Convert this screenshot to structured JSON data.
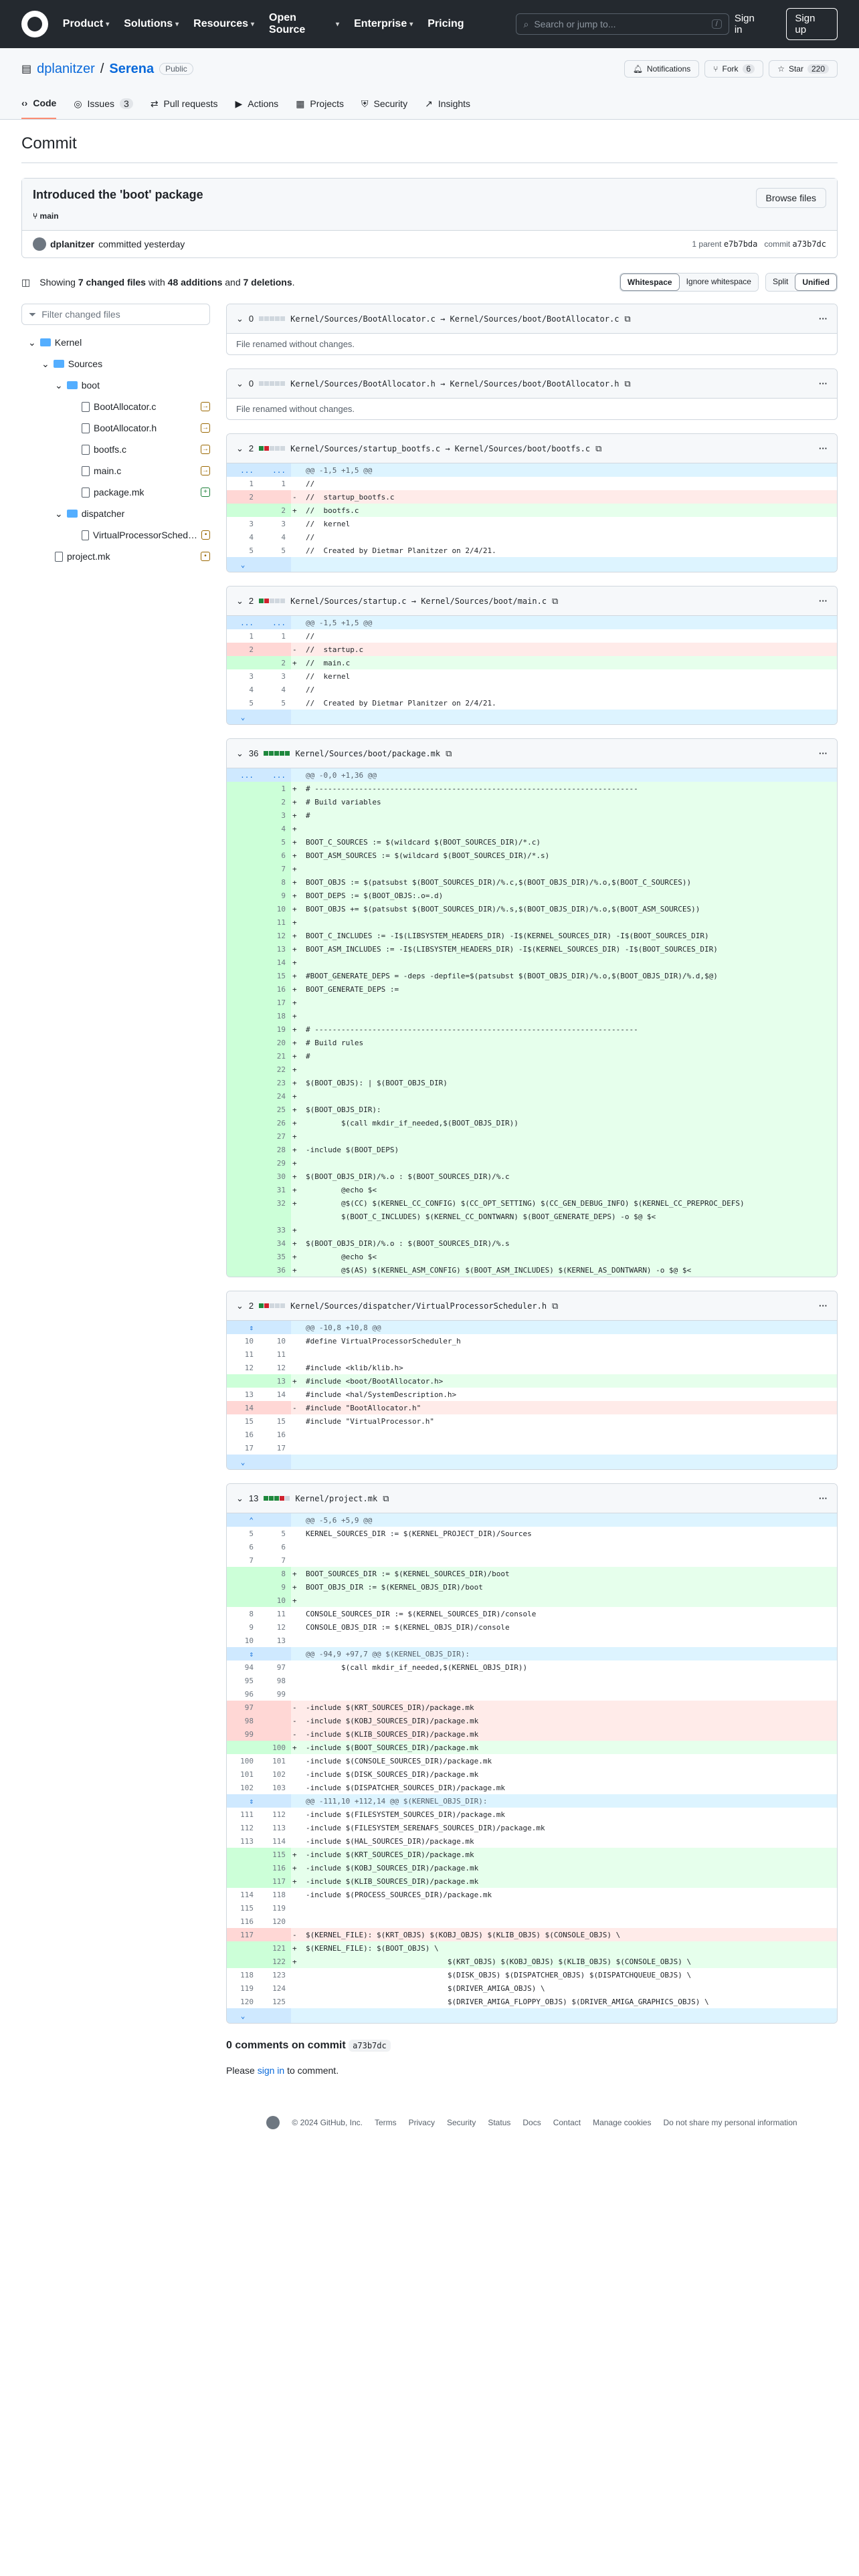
{
  "nav": {
    "items": [
      "Product",
      "Solutions",
      "Resources",
      "Open Source",
      "Enterprise",
      "Pricing"
    ],
    "search_placeholder": "Search or jump to...",
    "slash": "/",
    "signin": "Sign in",
    "signup": "Sign up"
  },
  "repo": {
    "owner": "dplanitzer",
    "name": "Serena",
    "visibility": "Public",
    "notifications": "Notifications",
    "fork": "Fork",
    "fork_count": "6",
    "star": "Star",
    "star_count": "220"
  },
  "tabs": [
    {
      "label": "Code",
      "count": ""
    },
    {
      "label": "Issues",
      "count": "3"
    },
    {
      "label": "Pull requests",
      "count": ""
    },
    {
      "label": "Actions",
      "count": ""
    },
    {
      "label": "Projects",
      "count": ""
    },
    {
      "label": "Security",
      "count": ""
    },
    {
      "label": "Insights",
      "count": ""
    }
  ],
  "page_title": "Commit",
  "commit": {
    "title": "Introduced the 'boot' package",
    "browse": "Browse files",
    "branch": "main",
    "author": "dplanitzer",
    "when": "committed yesterday",
    "parent_label": "1 parent",
    "parent": "e7b7bda",
    "commit_label": "commit",
    "hash": "a73b7dc"
  },
  "summary": {
    "pre": "Showing",
    "files": "7 changed files",
    "with": "with",
    "add": "48 additions",
    "and": "and",
    "del": "7 deletions",
    "dot": "."
  },
  "buttons": {
    "whitespace": "Whitespace",
    "ignore": "Ignore whitespace",
    "split": "Split",
    "unified": "Unified"
  },
  "filter_placeholder": "Filter changed files",
  "tree": [
    {
      "label": "Kernel",
      "type": "folder",
      "depth": 0,
      "status": ""
    },
    {
      "label": "Sources",
      "type": "folder",
      "depth": 1,
      "status": ""
    },
    {
      "label": "boot",
      "type": "folder",
      "depth": 2,
      "status": ""
    },
    {
      "label": "BootAllocator.c",
      "type": "file",
      "depth": 3,
      "status": "→"
    },
    {
      "label": "BootAllocator.h",
      "type": "file",
      "depth": 3,
      "status": "→"
    },
    {
      "label": "bootfs.c",
      "type": "file",
      "depth": 3,
      "status": "→"
    },
    {
      "label": "main.c",
      "type": "file",
      "depth": 3,
      "status": "→"
    },
    {
      "label": "package.mk",
      "type": "file",
      "depth": 3,
      "status": "+"
    },
    {
      "label": "dispatcher",
      "type": "folder",
      "depth": 2,
      "status": ""
    },
    {
      "label": "VirtualProcessorScheduler.h",
      "type": "file",
      "depth": 3,
      "status": "•"
    },
    {
      "label": "project.mk",
      "type": "file",
      "depth": 1,
      "status": "•"
    }
  ],
  "diffs": [
    {
      "count": "0",
      "bars": "nnnnn",
      "name": "Kernel/Sources/BootAllocator.c → Kernel/Sources/boot/BootAllocator.c",
      "note": "File renamed without changes.",
      "rows": []
    },
    {
      "count": "0",
      "bars": "nnnnn",
      "name": "Kernel/Sources/BootAllocator.h → Kernel/Sources/boot/BootAllocator.h",
      "note": "File renamed without changes.",
      "rows": []
    },
    {
      "count": "2",
      "bars": "grnnn",
      "name": "Kernel/Sources/startup_bootfs.c → Kernel/Sources/boot/bootfs.c",
      "note": "",
      "rows": [
        [
          "h",
          "...",
          "...",
          "",
          "@@ -1,5 +1,5 @@"
        ],
        [
          "c",
          "1",
          "1",
          "",
          "//"
        ],
        [
          "d",
          "2",
          "",
          "-",
          "//  startup_bootfs.c"
        ],
        [
          "a",
          "",
          "2",
          "+",
          "//  bootfs.c"
        ],
        [
          "c",
          "3",
          "3",
          "",
          "//  kernel"
        ],
        [
          "c",
          "4",
          "4",
          "",
          "//"
        ],
        [
          "c",
          "5",
          "5",
          "",
          "//  Created by Dietmar Planitzer on 2/4/21."
        ],
        [
          "e",
          "⌄",
          "",
          "",
          ""
        ]
      ]
    },
    {
      "count": "2",
      "bars": "grnnn",
      "name": "Kernel/Sources/startup.c → Kernel/Sources/boot/main.c",
      "note": "",
      "rows": [
        [
          "h",
          "...",
          "...",
          "",
          "@@ -1,5 +1,5 @@"
        ],
        [
          "c",
          "1",
          "1",
          "",
          "//"
        ],
        [
          "d",
          "2",
          "",
          "-",
          "//  startup.c"
        ],
        [
          "a",
          "",
          "2",
          "+",
          "//  main.c"
        ],
        [
          "c",
          "3",
          "3",
          "",
          "//  kernel"
        ],
        [
          "c",
          "4",
          "4",
          "",
          "//"
        ],
        [
          "c",
          "5",
          "5",
          "",
          "//  Created by Dietmar Planitzer on 2/4/21."
        ],
        [
          "e",
          "⌄",
          "",
          "",
          ""
        ]
      ]
    },
    {
      "count": "36",
      "bars": "ggggg",
      "name": "Kernel/Sources/boot/package.mk",
      "note": "",
      "rows": [
        [
          "h",
          "...",
          "...",
          "",
          "@@ -0,0 +1,36 @@"
        ],
        [
          "a",
          "",
          "1",
          "+",
          "# -------------------------------------------------------------------------"
        ],
        [
          "a",
          "",
          "2",
          "+",
          "# Build variables"
        ],
        [
          "a",
          "",
          "3",
          "+",
          "#"
        ],
        [
          "a",
          "",
          "4",
          "+",
          ""
        ],
        [
          "a",
          "",
          "5",
          "+",
          "BOOT_C_SOURCES := $(wildcard $(BOOT_SOURCES_DIR)/*.c)"
        ],
        [
          "a",
          "",
          "6",
          "+",
          "BOOT_ASM_SOURCES := $(wildcard $(BOOT_SOURCES_DIR)/*.s)"
        ],
        [
          "a",
          "",
          "7",
          "+",
          ""
        ],
        [
          "a",
          "",
          "8",
          "+",
          "BOOT_OBJS := $(patsubst $(BOOT_SOURCES_DIR)/%.c,$(BOOT_OBJS_DIR)/%.o,$(BOOT_C_SOURCES))"
        ],
        [
          "a",
          "",
          "9",
          "+",
          "BOOT_DEPS := $(BOOT_OBJS:.o=.d)"
        ],
        [
          "a",
          "",
          "10",
          "+",
          "BOOT_OBJS += $(patsubst $(BOOT_SOURCES_DIR)/%.s,$(BOOT_OBJS_DIR)/%.o,$(BOOT_ASM_SOURCES))"
        ],
        [
          "a",
          "",
          "11",
          "+",
          ""
        ],
        [
          "a",
          "",
          "12",
          "+",
          "BOOT_C_INCLUDES := -I$(LIBSYSTEM_HEADERS_DIR) -I$(KERNEL_SOURCES_DIR) -I$(BOOT_SOURCES_DIR)"
        ],
        [
          "a",
          "",
          "13",
          "+",
          "BOOT_ASM_INCLUDES := -I$(LIBSYSTEM_HEADERS_DIR) -I$(KERNEL_SOURCES_DIR) -I$(BOOT_SOURCES_DIR)"
        ],
        [
          "a",
          "",
          "14",
          "+",
          ""
        ],
        [
          "a",
          "",
          "15",
          "+",
          "#BOOT_GENERATE_DEPS = -deps -depfile=$(patsubst $(BOOT_OBJS_DIR)/%.o,$(BOOT_OBJS_DIR)/%.d,$@)"
        ],
        [
          "a",
          "",
          "16",
          "+",
          "BOOT_GENERATE_DEPS := "
        ],
        [
          "a",
          "",
          "17",
          "+",
          ""
        ],
        [
          "a",
          "",
          "18",
          "+",
          ""
        ],
        [
          "a",
          "",
          "19",
          "+",
          "# -------------------------------------------------------------------------"
        ],
        [
          "a",
          "",
          "20",
          "+",
          "# Build rules"
        ],
        [
          "a",
          "",
          "21",
          "+",
          "#"
        ],
        [
          "a",
          "",
          "22",
          "+",
          ""
        ],
        [
          "a",
          "",
          "23",
          "+",
          "$(BOOT_OBJS): | $(BOOT_OBJS_DIR)"
        ],
        [
          "a",
          "",
          "24",
          "+",
          ""
        ],
        [
          "a",
          "",
          "25",
          "+",
          "$(BOOT_OBJS_DIR):"
        ],
        [
          "a",
          "",
          "26",
          "+",
          "\t$(call mkdir_if_needed,$(BOOT_OBJS_DIR))"
        ],
        [
          "a",
          "",
          "27",
          "+",
          ""
        ],
        [
          "a",
          "",
          "28",
          "+",
          "-include $(BOOT_DEPS)"
        ],
        [
          "a",
          "",
          "29",
          "+",
          ""
        ],
        [
          "a",
          "",
          "30",
          "+",
          "$(BOOT_OBJS_DIR)/%.o : $(BOOT_SOURCES_DIR)/%.c"
        ],
        [
          "a",
          "",
          "31",
          "+",
          "\t@echo $<"
        ],
        [
          "a",
          "",
          "32",
          "+",
          "\t@$(CC) $(KERNEL_CC_CONFIG) $(CC_OPT_SETTING) $(CC_GEN_DEBUG_INFO) $(KERNEL_CC_PREPROC_DEFS)"
        ],
        [
          "a",
          "",
          "",
          "",
          "\t$(BOOT_C_INCLUDES) $(KERNEL_CC_DONTWARN) $(BOOT_GENERATE_DEPS) -o $@ $<"
        ],
        [
          "a",
          "",
          "33",
          "+",
          ""
        ],
        [
          "a",
          "",
          "34",
          "+",
          "$(BOOT_OBJS_DIR)/%.o : $(BOOT_SOURCES_DIR)/%.s"
        ],
        [
          "a",
          "",
          "35",
          "+",
          "\t@echo $<"
        ],
        [
          "a",
          "",
          "36",
          "+",
          "\t@$(AS) $(KERNEL_ASM_CONFIG) $(BOOT_ASM_INCLUDES) $(KERNEL_AS_DONTWARN) -o $@ $<"
        ]
      ]
    },
    {
      "count": "2",
      "bars": "grnnn",
      "name": "Kernel/Sources/dispatcher/VirtualProcessorScheduler.h",
      "note": "",
      "rows": [
        [
          "h",
          "⇕",
          "",
          "",
          "@@ -10,8 +10,8 @@"
        ],
        [
          "c",
          "10",
          "10",
          "",
          "#define VirtualProcessorScheduler_h"
        ],
        [
          "c",
          "11",
          "11",
          "",
          " "
        ],
        [
          "c",
          "12",
          "12",
          "",
          "#include <klib/klib.h>"
        ],
        [
          "a",
          "",
          "13",
          "+",
          "#include <boot/BootAllocator.h>"
        ],
        [
          "c",
          "13",
          "14",
          "",
          "#include <hal/SystemDescription.h>"
        ],
        [
          "d",
          "14",
          "",
          "-",
          "#include \"BootAllocator.h\""
        ],
        [
          "c",
          "15",
          "15",
          "",
          "#include \"VirtualProcessor.h\""
        ],
        [
          "c",
          "16",
          "16",
          "",
          ""
        ],
        [
          "c",
          "17",
          "17",
          "",
          ""
        ],
        [
          "e",
          "⌄",
          "",
          "",
          ""
        ]
      ]
    },
    {
      "count": "13",
      "bars": "gggrn",
      "name": "Kernel/project.mk",
      "note": "",
      "rows": [
        [
          "h",
          "⌃",
          "",
          "",
          "@@ -5,6 +5,9 @@"
        ],
        [
          "c",
          "5",
          "5",
          "",
          "KERNEL_SOURCES_DIR := $(KERNEL_PROJECT_DIR)/Sources"
        ],
        [
          "c",
          "6",
          "6",
          "",
          ""
        ],
        [
          "c",
          "7",
          "7",
          "",
          ""
        ],
        [
          "a",
          "",
          "8",
          "+",
          "BOOT_SOURCES_DIR := $(KERNEL_SOURCES_DIR)/boot"
        ],
        [
          "a",
          "",
          "9",
          "+",
          "BOOT_OBJS_DIR := $(KERNEL_OBJS_DIR)/boot"
        ],
        [
          "a",
          "",
          "10",
          "+",
          ""
        ],
        [
          "c",
          "8",
          "11",
          "",
          "CONSOLE_SOURCES_DIR := $(KERNEL_SOURCES_DIR)/console"
        ],
        [
          "c",
          "9",
          "12",
          "",
          "CONSOLE_OBJS_DIR := $(KERNEL_OBJS_DIR)/console"
        ],
        [
          "c",
          "10",
          "13",
          "",
          ""
        ],
        [
          "h",
          "⇕",
          "",
          "",
          "@@ -94,9 +97,7 @@ $(KERNEL_OBJS_DIR):"
        ],
        [
          "c",
          "94",
          "97",
          "",
          "\t$(call mkdir_if_needed,$(KERNEL_OBJS_DIR))"
        ],
        [
          "c",
          "95",
          "98",
          "",
          ""
        ],
        [
          "c",
          "96",
          "99",
          "",
          ""
        ],
        [
          "d",
          "97",
          "",
          "-",
          "-include $(KRT_SOURCES_DIR)/package.mk"
        ],
        [
          "d",
          "98",
          "",
          "-",
          "-include $(KOBJ_SOURCES_DIR)/package.mk"
        ],
        [
          "d",
          "99",
          "",
          "-",
          "-include $(KLIB_SOURCES_DIR)/package.mk"
        ],
        [
          "a",
          "",
          "100",
          "+",
          "-include $(BOOT_SOURCES_DIR)/package.mk"
        ],
        [
          "c",
          "100",
          "101",
          "",
          "-include $(CONSOLE_SOURCES_DIR)/package.mk"
        ],
        [
          "c",
          "101",
          "102",
          "",
          "-include $(DISK_SOURCES_DIR)/package.mk"
        ],
        [
          "c",
          "102",
          "103",
          "",
          "-include $(DISPATCHER_SOURCES_DIR)/package.mk"
        ],
        [
          "h",
          "⇕",
          "",
          "",
          "@@ -111,10 +112,14 @@ $(KERNEL_OBJS_DIR):"
        ],
        [
          "c",
          "111",
          "112",
          "",
          "-include $(FILESYSTEM_SOURCES_DIR)/package.mk"
        ],
        [
          "c",
          "112",
          "113",
          "",
          "-include $(FILESYSTEM_SERENAFS_SOURCES_DIR)/package.mk"
        ],
        [
          "c",
          "113",
          "114",
          "",
          "-include $(HAL_SOURCES_DIR)/package.mk"
        ],
        [
          "a",
          "",
          "115",
          "+",
          "-include $(KRT_SOURCES_DIR)/package.mk"
        ],
        [
          "a",
          "",
          "116",
          "+",
          "-include $(KOBJ_SOURCES_DIR)/package.mk"
        ],
        [
          "a",
          "",
          "117",
          "+",
          "-include $(KLIB_SOURCES_DIR)/package.mk"
        ],
        [
          "c",
          "114",
          "118",
          "",
          "-include $(PROCESS_SOURCES_DIR)/package.mk"
        ],
        [
          "c",
          "115",
          "119",
          "",
          ""
        ],
        [
          "c",
          "116",
          "120",
          "",
          ""
        ],
        [
          "d",
          "117",
          "",
          "-",
          "$(KERNEL_FILE): $(KRT_OBJS) $(KOBJ_OBJS) $(KLIB_OBJS) $(CONSOLE_OBJS) \\"
        ],
        [
          "a",
          "",
          "121",
          "+",
          "$(KERNEL_FILE): $(BOOT_OBJS) \\"
        ],
        [
          "a",
          "",
          "122",
          "+",
          "\t\t\t\t$(KRT_OBJS) $(KOBJ_OBJS) $(KLIB_OBJS) $(CONSOLE_OBJS) \\"
        ],
        [
          "c",
          "118",
          "123",
          "",
          "\t\t\t\t$(DISK_OBJS) $(DISPATCHER_OBJS) $(DISPATCHQUEUE_OBJS) \\"
        ],
        [
          "c",
          "119",
          "124",
          "",
          "\t\t\t\t$(DRIVER_AMIGA_OBJS) \\"
        ],
        [
          "c",
          "120",
          "125",
          "",
          "\t\t\t\t$(DRIVER_AMIGA_FLOPPY_OBJS) $(DRIVER_AMIGA_GRAPHICS_OBJS) \\"
        ],
        [
          "e",
          "⌄",
          "",
          "",
          ""
        ]
      ]
    }
  ],
  "comments": {
    "label": "0 comments on commit",
    "hash": "a73b7dc",
    "please": "Please",
    "signin": "sign in",
    "rest": "to comment."
  },
  "footer": [
    "© 2024 GitHub, Inc.",
    "Terms",
    "Privacy",
    "Security",
    "Status",
    "Docs",
    "Contact",
    "Manage cookies",
    "Do not share my personal information"
  ]
}
